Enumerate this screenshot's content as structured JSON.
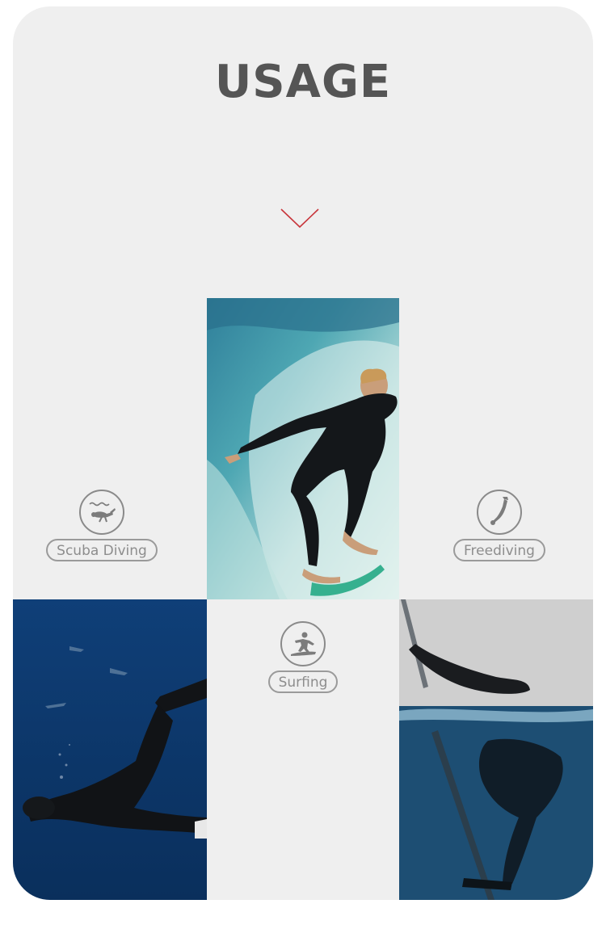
{
  "section": {
    "title": "USAGE"
  },
  "activities": [
    {
      "label": "Scuba Diving",
      "icon": "scuba-diver-icon"
    },
    {
      "label": "Surfing",
      "icon": "surfer-icon"
    },
    {
      "label": "Freediving",
      "icon": "freediver-icon"
    }
  ],
  "colors": {
    "card_bg": "#efefef",
    "title": "#555555",
    "accent": "#c8353b",
    "pill_border": "#9a9a9a"
  }
}
